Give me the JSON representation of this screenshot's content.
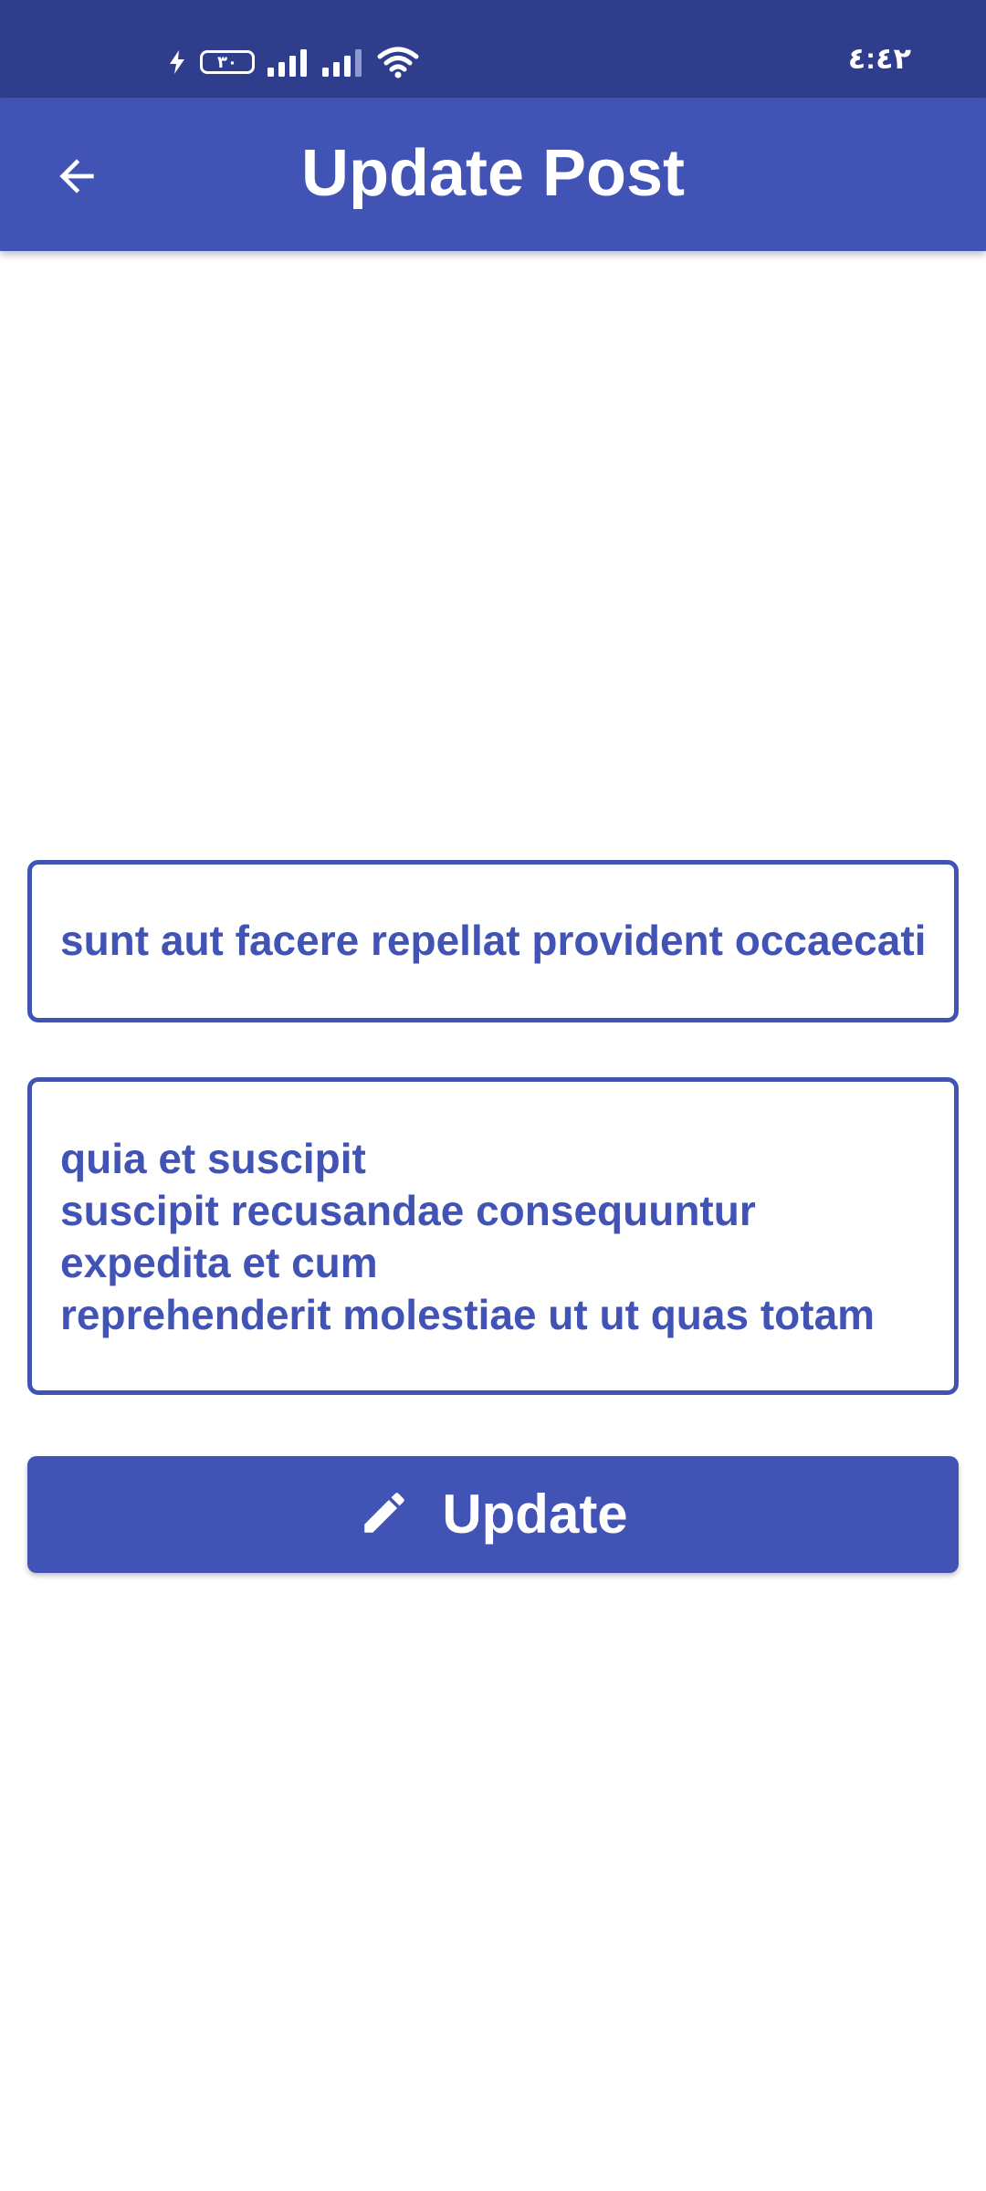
{
  "status_bar": {
    "battery_level": "٣٠",
    "time": "٤:٤٢",
    "icons": [
      "charging-icon",
      "battery-icon",
      "signal-icon",
      "signal-weak-icon",
      "wifi-icon"
    ]
  },
  "app_bar": {
    "title": "Update Post",
    "back_icon": "arrow-back-icon"
  },
  "form": {
    "title_value": "sunt aut facere repellat provident occaecati excepturi optio reprehenderit",
    "body_value": "quia et suscipit\nsuscipit recusandae consequuntur expedita et cum\nreprehenderit molestiae ut ut quas totam",
    "update_label": "Update",
    "update_icon": "pencil-icon"
  },
  "colors": {
    "status_bar": "#2f3e8c",
    "primary": "#4153b5",
    "background": "#ffffff"
  }
}
